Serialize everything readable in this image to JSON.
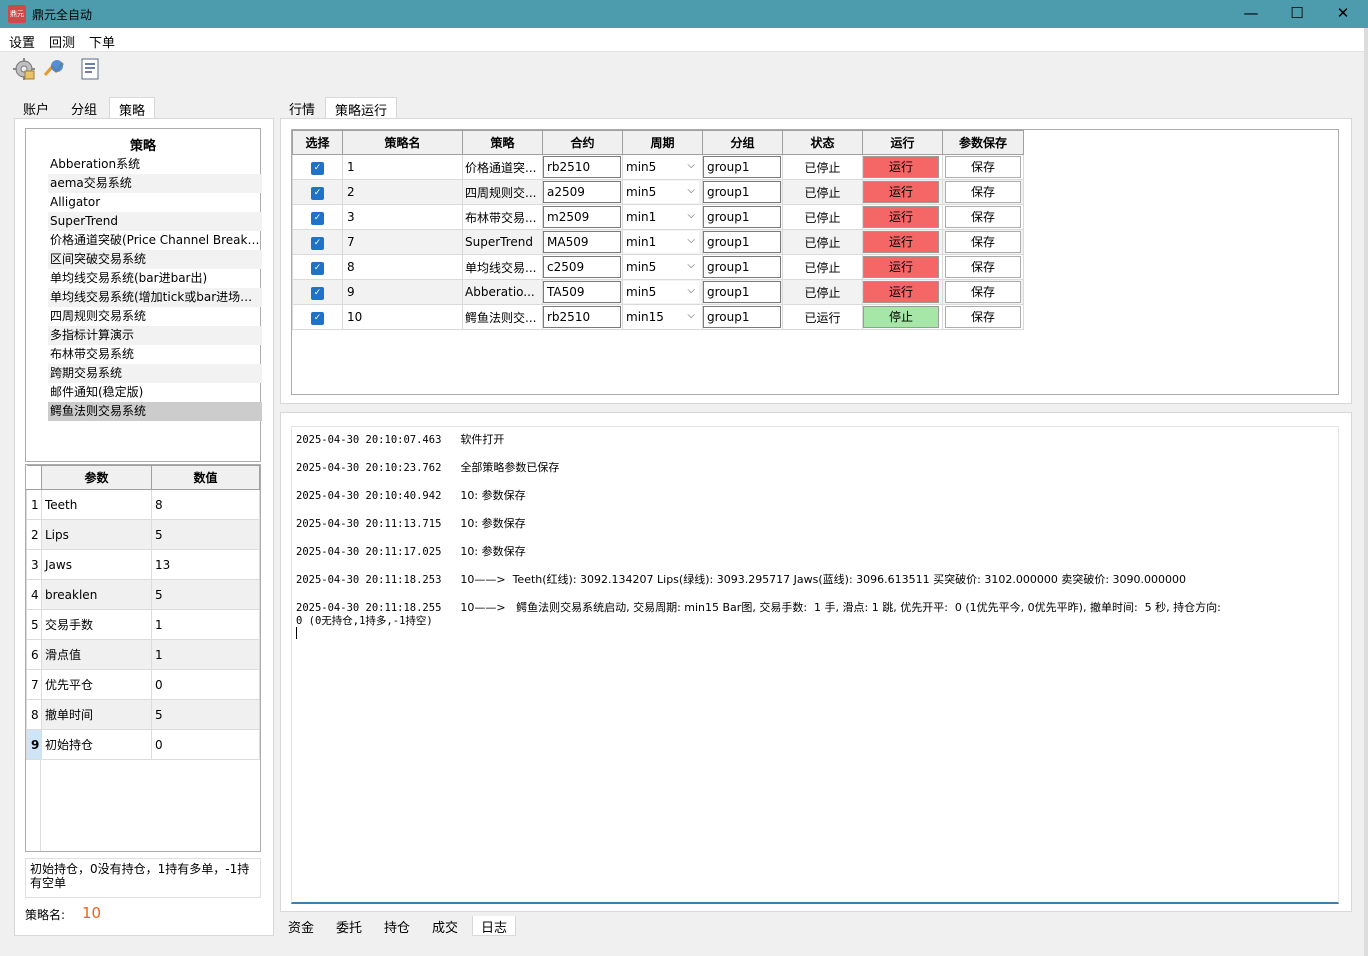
{
  "window": {
    "title": "鼎元全自动",
    "icon_label": "鼎元"
  },
  "menu": [
    "设置",
    "回测",
    "下单"
  ],
  "toolbar_icons": [
    "settings-icon",
    "backtest-icon",
    "document-icon"
  ],
  "left_tabs": [
    "账户",
    "分组",
    "策略"
  ],
  "left_active_tab": "策略",
  "strategy_list": {
    "header": "策略",
    "items": [
      "Abberation系统",
      "aema交易系统",
      "Alligator",
      "SuperTrend",
      "价格通道突破(Price Channel Break…",
      "区间突破交易系统",
      "单均线交易系统(bar进bar出)",
      "单均线交易系统(增加tick或bar进场…",
      "四周规则交易系统",
      "多指标计算演示",
      "布林带交易系统",
      "跨期交易系统",
      "邮件通知(稳定版)",
      "鳄鱼法则交易系统"
    ],
    "selected_index": 13
  },
  "params": {
    "headers": [
      "参数",
      "数值"
    ],
    "rows": [
      {
        "n": "1",
        "name": "Teeth",
        "value": "8"
      },
      {
        "n": "2",
        "name": "Lips",
        "value": "5"
      },
      {
        "n": "3",
        "name": "Jaws",
        "value": "13"
      },
      {
        "n": "4",
        "name": "breaklen",
        "value": "5"
      },
      {
        "n": "5",
        "name": "交易手数",
        "value": "1"
      },
      {
        "n": "6",
        "name": "滑点值",
        "value": "1"
      },
      {
        "n": "7",
        "name": "优先平仓",
        "value": "0"
      },
      {
        "n": "8",
        "name": "撤单时间",
        "value": "5"
      },
      {
        "n": "9",
        "name": "初始持仓",
        "value": "0"
      }
    ]
  },
  "param_description": "初始持仓，0没有持仓，1持有多单，-1持有空单",
  "strategy_name_label": "策略名:",
  "strategy_name_value": "10",
  "right_tabs": [
    "行情",
    "策略运行"
  ],
  "right_active_tab": "策略运行",
  "strategy_table": {
    "headers": [
      "选择",
      "策略名",
      "策略",
      "合约",
      "周期",
      "分组",
      "状态",
      "运行",
      "参数保存"
    ],
    "rows": [
      {
        "checked": "✓",
        "name": "1",
        "strategy": "价格通道突...",
        "contract": "rb2510",
        "period": "min5",
        "group": "group1",
        "status": "已停止",
        "run": "运行",
        "save": "保存"
      },
      {
        "checked": "✓",
        "name": "2",
        "strategy": "四周规则交...",
        "contract": "a2509",
        "period": "min5",
        "group": "group1",
        "status": "已停止",
        "run": "运行",
        "save": "保存"
      },
      {
        "checked": "✓",
        "name": "3",
        "strategy": "布林带交易...",
        "contract": "m2509",
        "period": "min1",
        "group": "group1",
        "status": "已停止",
        "run": "运行",
        "save": "保存"
      },
      {
        "checked": "✓",
        "name": "7",
        "strategy": "SuperTrend",
        "contract": "MA509",
        "period": "min1",
        "group": "group1",
        "status": "已停止",
        "run": "运行",
        "save": "保存"
      },
      {
        "checked": "✓",
        "name": "8",
        "strategy": "单均线交易...",
        "contract": "c2509",
        "period": "min5",
        "group": "group1",
        "status": "已停止",
        "run": "运行",
        "save": "保存"
      },
      {
        "checked": "✓",
        "name": "9",
        "strategy": "Abberatio...",
        "contract": "TA509",
        "period": "min5",
        "group": "group1",
        "status": "已停止",
        "run": "运行",
        "save": "保存"
      },
      {
        "checked": "✓",
        "name": "10",
        "strategy": "鳄鱼法则交...",
        "contract": "rb2510",
        "period": "min15",
        "group": "group1",
        "status": "已运行",
        "run": "停止",
        "save": "保存"
      }
    ],
    "colors": {
      "stopped_run_button": "#f56666",
      "running_run_button": "#a6e6a6"
    }
  },
  "log": [
    {
      "time": "2025-04-30 20:10:07.463",
      "msg": "软件打开"
    },
    {
      "time": "2025-04-30 20:10:23.762",
      "msg": "全部策略参数已保存"
    },
    {
      "time": "2025-04-30 20:10:40.942",
      "msg": "10: 参数保存"
    },
    {
      "time": "2025-04-30 20:11:13.715",
      "msg": "10: 参数保存"
    },
    {
      "time": "2025-04-30 20:11:17.025",
      "msg": "10: 参数保存"
    },
    {
      "time": "2025-04-30 20:11:18.253",
      "msg": "10——>  Teeth(红线): 3092.134207 Lips(绿线): 3093.295717 Jaws(蓝线): 3096.613511 买突破价: 3102.000000 卖突破价: 3090.000000"
    },
    {
      "time": "2025-04-30 20:11:18.255",
      "msg": "10——>   鳄鱼法则交易系统启动, 交易周期: min15 Bar图, 交易手数:  1 手, 滑点: 1 跳, 优先开平:  0 (1优先平今, 0优先平昨), 撤单时间:  5 秒, 持仓方向:",
      "cont": "0 (0无持仓,1持多,-1持空)"
    }
  ],
  "bottom_tabs": [
    "资金",
    "委托",
    "持仓",
    "成交",
    "日志"
  ],
  "bottom_active_tab": "日志"
}
